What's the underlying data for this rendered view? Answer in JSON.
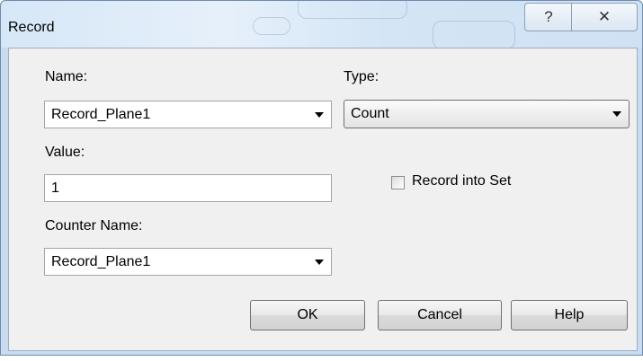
{
  "window": {
    "title": "Record",
    "help_glyph": "?",
    "close_glyph": "✕"
  },
  "form": {
    "name_label": "Name:",
    "name_value": "Record_Plane1",
    "type_label": "Type:",
    "type_value": "Count",
    "value_label": "Value:",
    "value_value": "1",
    "record_into_set_label": "Record into Set",
    "record_into_set_checked": false,
    "counter_name_label": "Counter Name:",
    "counter_name_value": "Record_Plane1"
  },
  "buttons": {
    "ok": "OK",
    "cancel": "Cancel",
    "help": "Help"
  }
}
